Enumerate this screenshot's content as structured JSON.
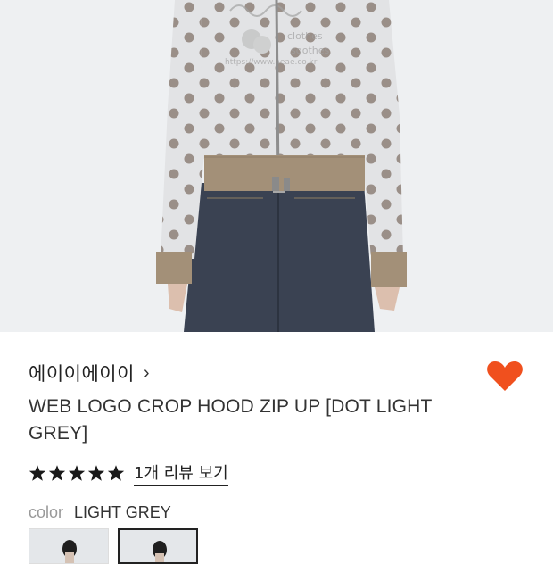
{
  "product": {
    "brand": "에이이에이이",
    "brand_chevron": "›",
    "title": "WEB LOGO CROP HOOD ZIP UP [DOT LIGHT GREY]",
    "rating_stars": 5,
    "review_link": "1개 리뷰 보기",
    "color_label": "color",
    "color_value": "LIGHT GREY",
    "wishlist_color": "#f0501e",
    "star_color": "#1a1a1a"
  },
  "image": {
    "background": "#eef0f2",
    "hoodie_color": "#e2e3e5",
    "dot_color": "#9a8f88",
    "rib_color": "#a39078",
    "denim_color": "#3a4252"
  },
  "swatches": [
    {
      "name": "option-1",
      "selected": false
    },
    {
      "name": "option-2",
      "selected": true
    }
  ]
}
